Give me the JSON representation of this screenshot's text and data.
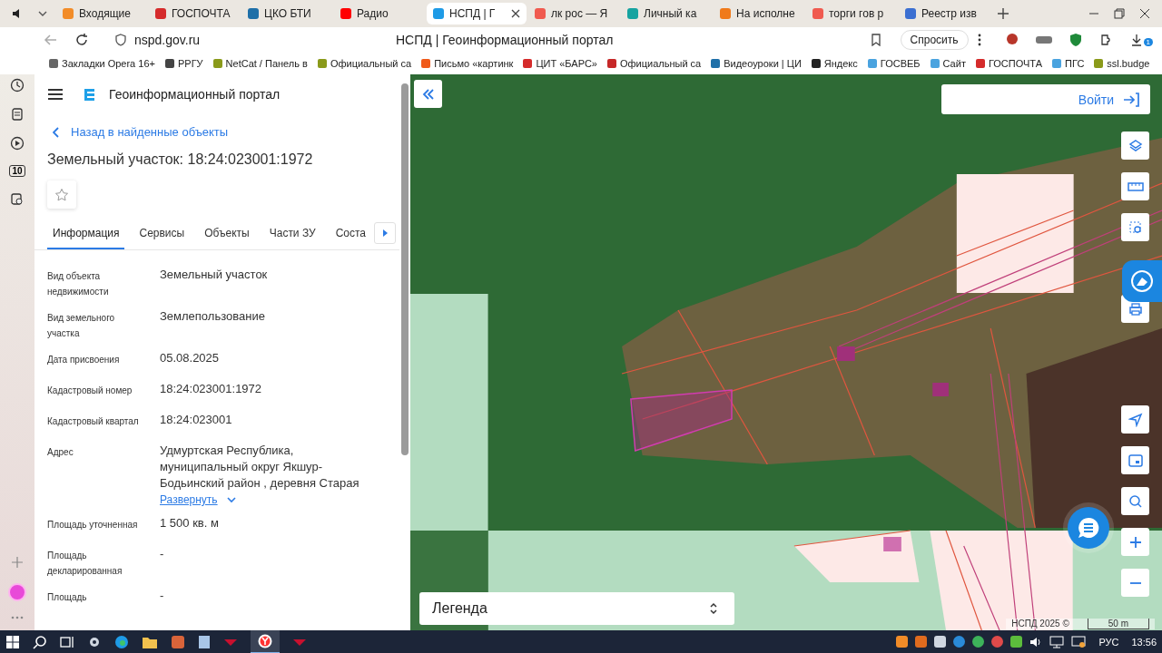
{
  "browser": {
    "tabs": [
      {
        "label": "Входящие",
        "color": "#f28c28",
        "selected": false
      },
      {
        "label": "ГОСПОЧТА",
        "color": "#d52b2b",
        "selected": false
      },
      {
        "label": "ЦКО БТИ",
        "color": "#1e6fa8",
        "selected": false
      },
      {
        "label": "Радио",
        "color": "#ff0000",
        "selected": false
      },
      {
        "label": "НСПД | Г",
        "color": "#1e9be6",
        "selected": true
      },
      {
        "label": "лк рос — Я",
        "color": "#f05a4f",
        "selected": false
      },
      {
        "label": "Личный ка",
        "color": "#16a3a0",
        "selected": false
      },
      {
        "label": "На исполне",
        "color": "#f07a1a",
        "selected": false
      },
      {
        "label": "торги гов р",
        "color": "#f05a4f",
        "selected": false
      },
      {
        "label": "Реестр изв",
        "color": "#3b6fd1",
        "selected": false
      }
    ],
    "address": "nspd.gov.ru",
    "page_title": "НСПД | Геоинформационный портал",
    "ask_button": "Спросить",
    "extension_badge": "1",
    "bookmarks": [
      {
        "label": "Закладки Opera 16+",
        "color": "#666666"
      },
      {
        "label": "РРГУ",
        "color": "#444444"
      },
      {
        "label": "NetCat / Панель в",
        "color": "#8a9a1a"
      },
      {
        "label": "Официальный са",
        "color": "#8a9a1a"
      },
      {
        "label": "Письмо «картинк",
        "color": "#f05a1a"
      },
      {
        "label": "ЦИТ «БАРС»",
        "color": "#d52b2b"
      },
      {
        "label": "Официальный са",
        "color": "#c62828"
      },
      {
        "label": "Видеоуроки | ЦИ",
        "color": "#1e6fa8"
      },
      {
        "label": "Яндекс",
        "color": "#222222"
      },
      {
        "label": "ГОСВЕБ",
        "color": "#4aa3df"
      },
      {
        "label": "Сайт",
        "color": "#4aa3df"
      },
      {
        "label": "ГОСПОЧТА",
        "color": "#d52b2b"
      },
      {
        "label": "ПГС",
        "color": "#4aa3df"
      },
      {
        "label": "ssl.budge",
        "color": "#8a9a1a"
      }
    ],
    "sidebar_badge": "10"
  },
  "panel": {
    "app_title": "Геоинформационный портал",
    "back_link": "Назад в найденные объекты",
    "heading": "Земельный участок: 18:24:023001:1972",
    "tabs": [
      {
        "label": "Информация",
        "selected": true
      },
      {
        "label": "Сервисы",
        "selected": false
      },
      {
        "label": "Объекты",
        "selected": false
      },
      {
        "label": "Части ЗУ",
        "selected": false
      },
      {
        "label": "Соста",
        "selected": false
      }
    ],
    "fields": [
      {
        "label": "Вид объекта недвижимости",
        "value": "Земельный участок"
      },
      {
        "label": "Вид земельного участка",
        "value": "Землепользование"
      },
      {
        "label": "Дата присвоения",
        "value": "05.08.2025"
      },
      {
        "label": "Кадастровый номер",
        "value": "18:24:023001:1972"
      },
      {
        "label": "Кадастровый квартал",
        "value": "18:24:023001"
      },
      {
        "label": "Адрес",
        "value": "Удмуртская Республика, муниципальный округ Якшур-Бодьинский район , деревня Старая",
        "expand_link": "Развернуть"
      },
      {
        "label": "Площадь уточненная",
        "value": "1 500 кв. м"
      },
      {
        "label": "Площадь декларированная",
        "value": "-"
      },
      {
        "label": "Площадь",
        "value": "-"
      }
    ]
  },
  "map": {
    "login_button": "Войти",
    "legend": "Легенда",
    "attribution": "НСПД 2025 ©",
    "scale": "50 m"
  },
  "taskbar": {
    "language": "РУС",
    "time": "13:56"
  }
}
